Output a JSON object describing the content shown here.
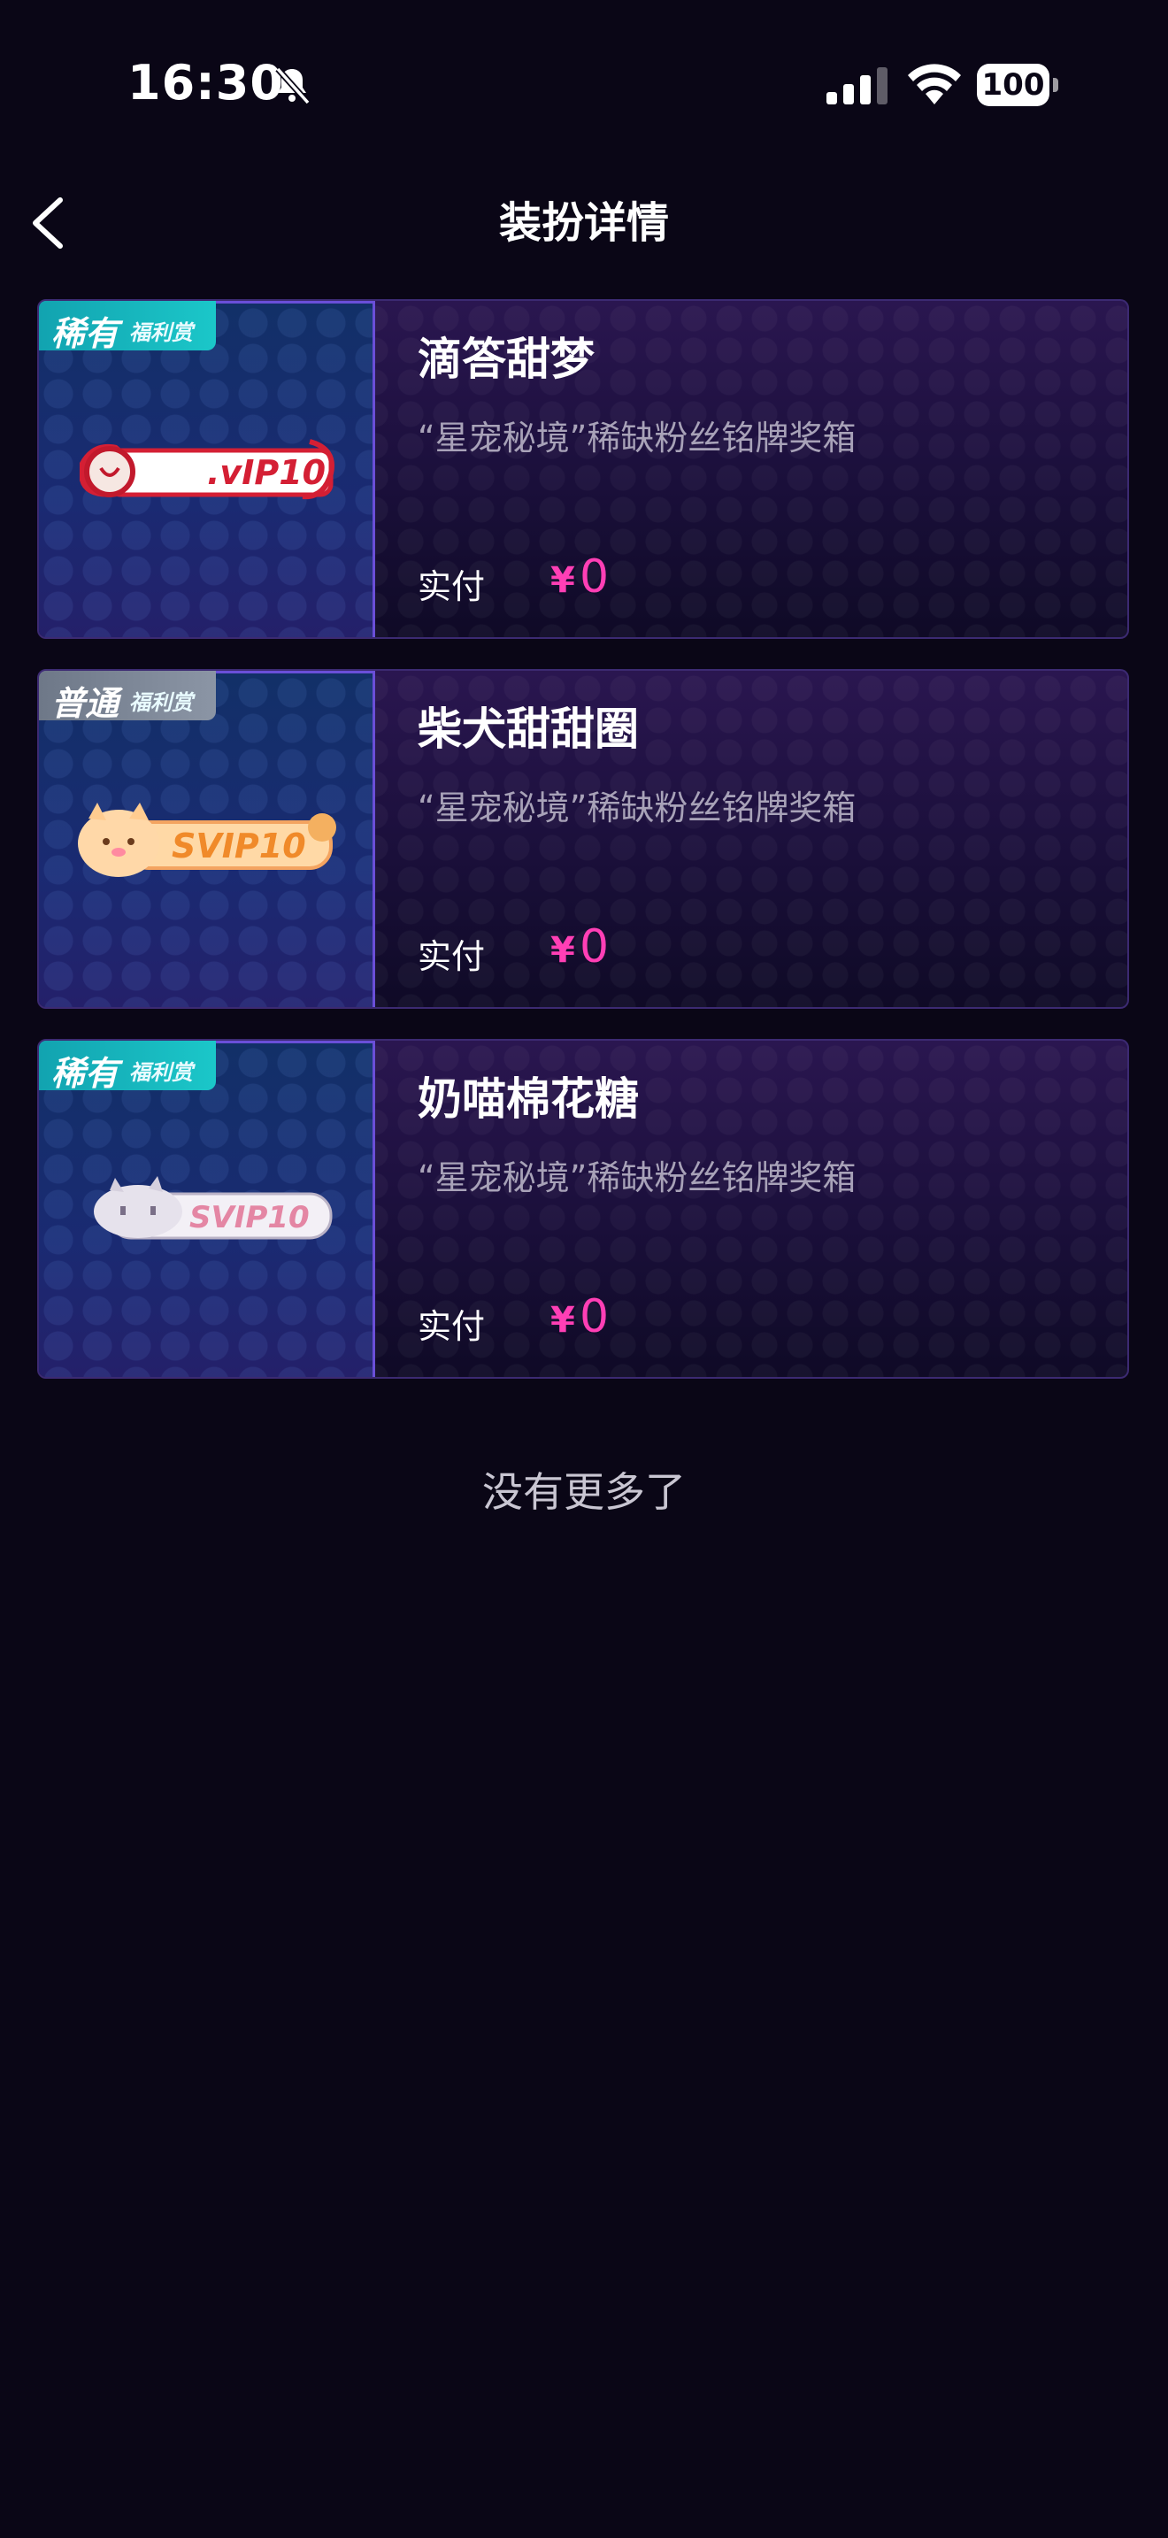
{
  "status_bar": {
    "time": "16:30",
    "battery": "100",
    "icons": [
      "bell-slash-icon",
      "cellular-signal-icon",
      "wifi-icon",
      "battery-icon"
    ]
  },
  "nav": {
    "back_icon": "chevron-left-icon",
    "title": "装扮详情"
  },
  "items": [
    {
      "tag": {
        "main": "稀有",
        "sub": "福利赏"
      },
      "badge_text": ".vIP10",
      "name": "滴答甜梦",
      "desc": "“星宠秘境”稀缺粉丝铭牌奖箱",
      "paid_label": "实付",
      "price_symbol": "¥",
      "price": "0"
    },
    {
      "tag": {
        "main": "普通",
        "sub": "福利赏"
      },
      "badge_text": "SVIP10",
      "name": "柴犬甜甜圈",
      "desc": "“星宠秘境”稀缺粉丝铭牌奖箱",
      "paid_label": "实付",
      "price_symbol": "¥",
      "price": "0"
    },
    {
      "tag": {
        "main": "稀有",
        "sub": "福利赏"
      },
      "badge_text": "SVIP10",
      "name": "奶喵棉花糖",
      "desc": "“星宠秘境”稀缺粉丝铭牌奖箱",
      "paid_label": "实付",
      "price_symbol": "¥",
      "price": "0"
    }
  ],
  "end_text": "没有更多了",
  "colors": {
    "background": "#0a0616",
    "price": "#ff3fb5",
    "rare_tag": "#1bc7c9",
    "normal_tag": "#8b95a5"
  }
}
